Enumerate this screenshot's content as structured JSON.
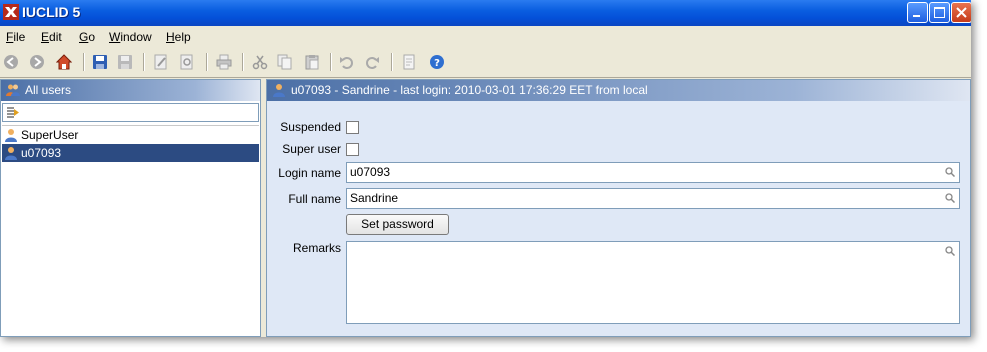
{
  "window": {
    "title": "IUCLID 5"
  },
  "menu": [
    {
      "label": "File",
      "mnemonic": "F",
      "rest": "ile"
    },
    {
      "label": "Edit",
      "mnemonic": "E",
      "rest": "dit"
    },
    {
      "label": "Go",
      "mnemonic": "G",
      "rest": "o"
    },
    {
      "label": "Window",
      "mnemonic": "W",
      "rest": "indow"
    },
    {
      "label": "Help",
      "mnemonic": "H",
      "rest": "elp"
    }
  ],
  "toolbar_icons": [
    "back-icon",
    "forward-icon",
    "home-icon",
    "save-icon",
    "save-all-icon",
    "edit-icon",
    "preview-icon",
    "print-icon",
    "cut-icon",
    "copy-icon",
    "paste-icon",
    "undo-icon",
    "redo-icon",
    "document-icon",
    "help-icon"
  ],
  "left_panel": {
    "header": "All users",
    "filter_value": "",
    "users": [
      {
        "label": "SuperUser",
        "selected": false
      },
      {
        "label": "u07093",
        "selected": true
      }
    ]
  },
  "right_panel": {
    "header": "u07093 - Sandrine - last login: 2010-03-01 17:36:29 EET from local",
    "fields": {
      "suspended_label": "Suspended",
      "suspended_checked": false,
      "super_user_label": "Super user",
      "super_user_checked": false,
      "login_name_label": "Login name",
      "login_name_value": "u07093",
      "full_name_label": "Full name",
      "full_name_value": "Sandrine",
      "set_password_label": "Set password",
      "remarks_label": "Remarks",
      "remarks_value": ""
    }
  },
  "colors": {
    "title_bar": "#0a5ee0",
    "header_gradient_start": "#4b6fa6",
    "selection": "#2c4b82",
    "form_background": "#dfe8f6"
  }
}
